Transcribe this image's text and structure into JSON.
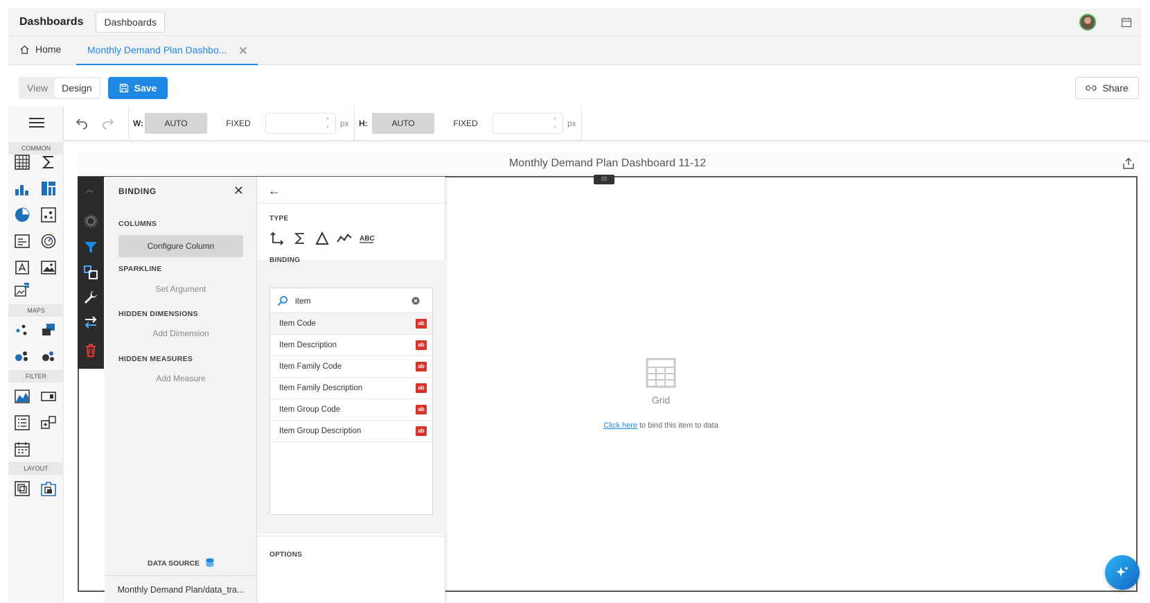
{
  "header": {
    "app_title": "Dashboards",
    "crumb_button": "Dashboards"
  },
  "tabs": {
    "home_label": "Home",
    "active_label": "Monthly Demand Plan Dashbo..."
  },
  "mode": {
    "view_label": "View",
    "design_label": "Design",
    "save_label": "Save",
    "share_label": "Share"
  },
  "toolbox": {
    "sections": [
      "COMMON",
      "MAPS",
      "FILTER",
      "LAYOUT"
    ]
  },
  "design_toolbar": {
    "width_label": "W:",
    "height_label": "H:",
    "auto_label": "AUTO",
    "fixed_label": "FIXED",
    "unit_label": "px"
  },
  "canvas": {
    "dashboard_title": "Monthly Demand Plan Dashboard 11-12",
    "placeholder_label": "Grid",
    "placeholder_link": "Click here",
    "placeholder_text": " to bind this item to data"
  },
  "binding_panel": {
    "title": "BINDING",
    "columns_label": "COLUMNS",
    "configure_column": "Configure Column",
    "sparkline_label": "SPARKLINE",
    "set_argument": "Set Argument",
    "hidden_dimensions_label": "HIDDEN DIMENSIONS",
    "add_dimension": "Add Dimension",
    "hidden_measures_label": "HIDDEN MEASURES",
    "add_measure": "Add Measure",
    "data_source_label": "DATA SOURCE",
    "data_source_value": "Monthly Demand Plan/data_tra..."
  },
  "field_panel": {
    "type_label": "TYPE",
    "binding_label": "BINDING",
    "options_label": "OPTIONS",
    "search_value": "item",
    "fields": [
      {
        "name": "Item Code",
        "type_badge": "ab"
      },
      {
        "name": "Item Description",
        "type_badge": "ab"
      },
      {
        "name": "Item Family Code",
        "type_badge": "ab"
      },
      {
        "name": "Item Family Description",
        "type_badge": "ab"
      },
      {
        "name": "Item Group Code",
        "type_badge": "ab"
      },
      {
        "name": "Item Group Description",
        "type_badge": "ab"
      }
    ]
  },
  "colors": {
    "accent": "#1e88e5",
    "string_badge": "#d9342b"
  }
}
